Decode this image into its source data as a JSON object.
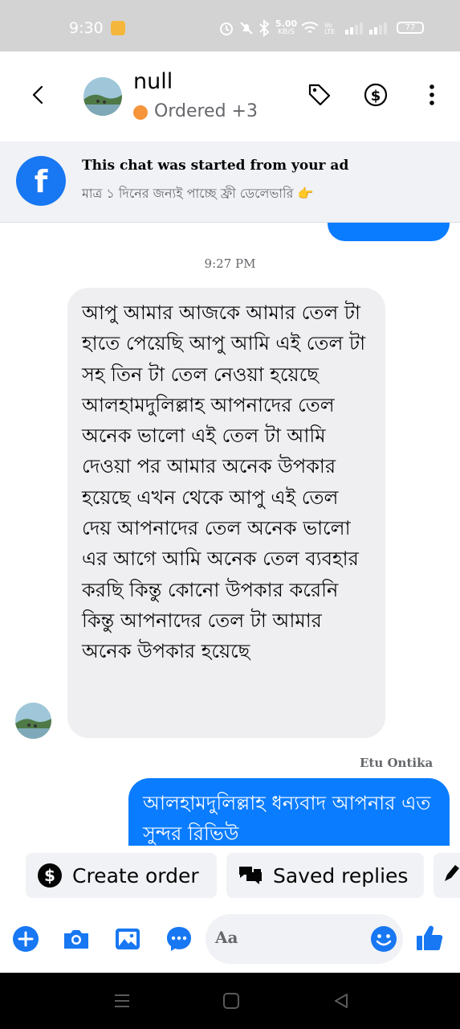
{
  "status_bar": {
    "time": "9:30",
    "network_speed": "5.00",
    "network_speed_unit": "KB/S",
    "volte_label": "Vo LTE",
    "battery": "77"
  },
  "header": {
    "contact_name": "null",
    "status_text": "Ordered +3",
    "status_color": "#f6953b"
  },
  "ad_banner": {
    "title": "This chat was started from your ad",
    "subtitle": "মাত্র ১ দিনের জন্যই পাচ্ছে ফ্রী ডেলেভারি 👉"
  },
  "conversation": {
    "timestamp": "9:27 PM",
    "incoming_message": "আপু আমার আজকে আমার তেল টা হাতে পেয়েছি আপু আমি এই তেল  টা সহ তিন টা তেল নেওয়া হয়েছে আলহামদুলিল্লাহ আপনাদের তেল অনেক ভালো এই তেল টা আমি দেওয়া পর আমার অনেক উপকার হয়েছে এখন থেকে আপু এই তেল দেয় আপনাদের তেল অনেক ভালো এর আগে আমি অনেক তেল ব্যবহার করছি  কিন্তু কোনো উপকার করেনি কিন্তু আপনাদের তেল টা আমার অনেক উপকার হয়েছে",
    "sender_label": "Etu Ontika",
    "outgoing_message": "আলহামদুলিল্লাহ ধন্যবাদ আপনার এত সুন্দর রিভিউ"
  },
  "quick_actions": {
    "create_order_label": "Create order",
    "saved_replies_label": "Saved replies"
  },
  "composer": {
    "placeholder": "Aa"
  },
  "colors": {
    "accent": "#1877f2",
    "outgoing_bubble": "#0a7cff",
    "incoming_bubble": "#efeff1"
  }
}
